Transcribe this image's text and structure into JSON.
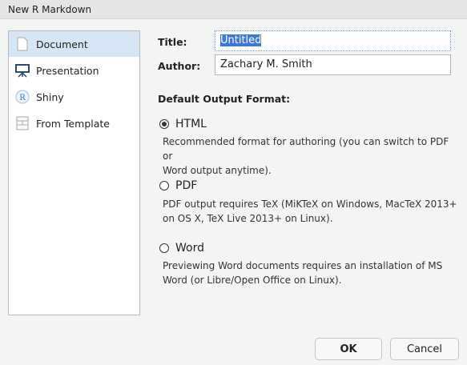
{
  "window": {
    "title": "New R Markdown"
  },
  "sidebar": {
    "items": [
      {
        "label": "Document",
        "icon": "document-icon",
        "selected": true
      },
      {
        "label": "Presentation",
        "icon": "presentation-icon"
      },
      {
        "label": "Shiny",
        "icon": "shiny-r-icon"
      },
      {
        "label": "From Template",
        "icon": "template-icon"
      }
    ]
  },
  "form": {
    "title_label": "Title:",
    "title_value": "Untitled",
    "author_label": "Author:",
    "author_value": "Zachary M. Smith"
  },
  "output": {
    "heading": "Default Output Format:",
    "options": [
      {
        "label": "HTML",
        "selected": true,
        "desc1": "Recommended format for authoring (you can switch to PDF or",
        "desc2": "Word output anytime)."
      },
      {
        "label": "PDF",
        "selected": false,
        "desc1": "PDF output requires TeX (MiKTeX on Windows, MacTeX 2013+",
        "desc2": "on OS X, TeX Live 2013+ on Linux)."
      },
      {
        "label": "Word",
        "selected": false,
        "desc1": "Previewing Word documents requires an installation of MS",
        "desc2": "Word (or Libre/Open Office on Linux)."
      }
    ]
  },
  "buttons": {
    "ok": "OK",
    "cancel": "Cancel"
  }
}
